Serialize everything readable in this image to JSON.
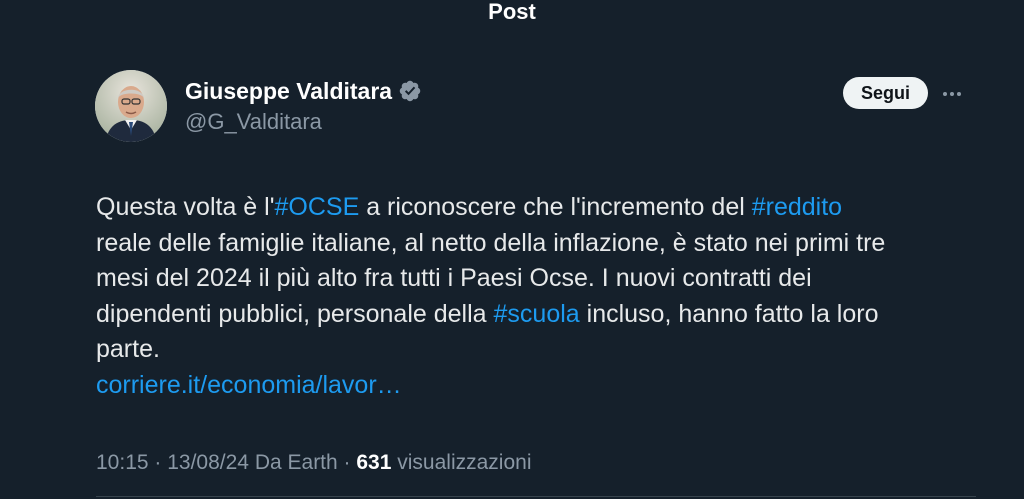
{
  "header": {
    "title": "Post"
  },
  "author": {
    "display_name": "Giuseppe Valditara",
    "handle": "@G_Valditara",
    "verified_icon": "verified-badge-icon"
  },
  "actions": {
    "follow_label": "Segui",
    "more_icon": "more-horizontal-icon"
  },
  "tweet": {
    "segments": [
      {
        "type": "text",
        "value": "Questa volta è l'"
      },
      {
        "type": "hashtag",
        "value": "#OCSE"
      },
      {
        "type": "text",
        "value": " a riconoscere che l'incremento del "
      },
      {
        "type": "hashtag",
        "value": "#reddito"
      },
      {
        "type": "text",
        "value": "\nreale delle famiglie italiane, al netto della inflazione, è stato nei primi tre\nmesi del 2024 il più alto fra tutti i Paesi Ocse. I nuovi contratti dei\ndipendenti pubblici, personale della "
      },
      {
        "type": "hashtag",
        "value": "#scuola"
      },
      {
        "type": "text",
        "value": " incluso, hanno fatto la loro\nparte.\n"
      },
      {
        "type": "link",
        "value": "corriere.it/economia/lavor…"
      }
    ]
  },
  "meta": {
    "time": "10:15",
    "separator": " · ",
    "date": "13/08/24",
    "source": "Da Earth",
    "views_count": "631",
    "views_label": "visualizzazioni"
  },
  "colors": {
    "background": "#15202b",
    "accent": "#1d9bf0",
    "text": "#e7e9ea",
    "muted": "#8b98a5"
  }
}
